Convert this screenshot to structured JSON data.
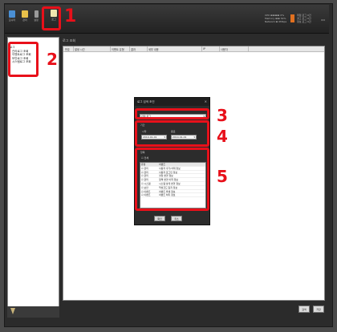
{
  "toolbar": {
    "icons": [
      {
        "name": "monitor-icon",
        "label": "모니터",
        "color": "#4a8fd4"
      },
      {
        "name": "document-icon",
        "label": "관리",
        "color": "#e8c04a"
      },
      {
        "name": "pen-icon",
        "label": "설정",
        "color": "#9a9a9a"
      },
      {
        "name": "log-icon",
        "label": "로그",
        "color": "#f0e6b0"
      }
    ],
    "status_lines": [
      "CPU ▬▬▬▬ 0%",
      "Memory ▬▬ 54%",
      "Network ▬ 0Mbps"
    ],
    "alert_lines": [
      "위험 로그 0건",
      "경고 로그 0건",
      "정보 로그 0건"
    ]
  },
  "callouts": [
    "1",
    "2",
    "3",
    "4",
    "5"
  ],
  "sidebar": {
    "root": "로그",
    "items": [
      "관리로그 조회",
      "이벤트로그 조회",
      "보안로그 조회",
      "시스템로그 조회"
    ]
  },
  "main": {
    "title": "로그 조회",
    "columns": [
      "번호",
      "발생 시간",
      "이벤트 유형",
      "결과",
      "세부 내용",
      "IP",
      "사용자"
    ],
    "buttons": [
      "검색",
      "저장"
    ]
  },
  "dialog": {
    "title": "로그 검색 조건",
    "close": "×",
    "type_select": "관리 로그",
    "period_label": "기간",
    "from_label": "시작",
    "to_label": "종료",
    "from_value": "2014-01-01",
    "to_value": "2014-01-01",
    "filter_label": "항목",
    "all_label": "전체",
    "list_headers": [
      "유형",
      "이벤트"
    ],
    "list_rows": [
      [
        "관리",
        "사용자 추가/삭제 정보"
      ],
      [
        "관리",
        "사용자 로그인 정보"
      ],
      [
        "관리",
        "설정 변경 정보"
      ],
      [
        "관리",
        "정책 변경 이력 정보"
      ],
      [
        "시스템",
        "시스템 상태 변경 정보"
      ],
      [
        "보안",
        "악성코드 탐지 정보"
      ],
      [
        "이벤트",
        "이벤트 발생 정보"
      ],
      [
        "이벤트",
        "이벤트 처리 정보"
      ]
    ],
    "ok_button": "확인",
    "cancel_button": "취소"
  }
}
